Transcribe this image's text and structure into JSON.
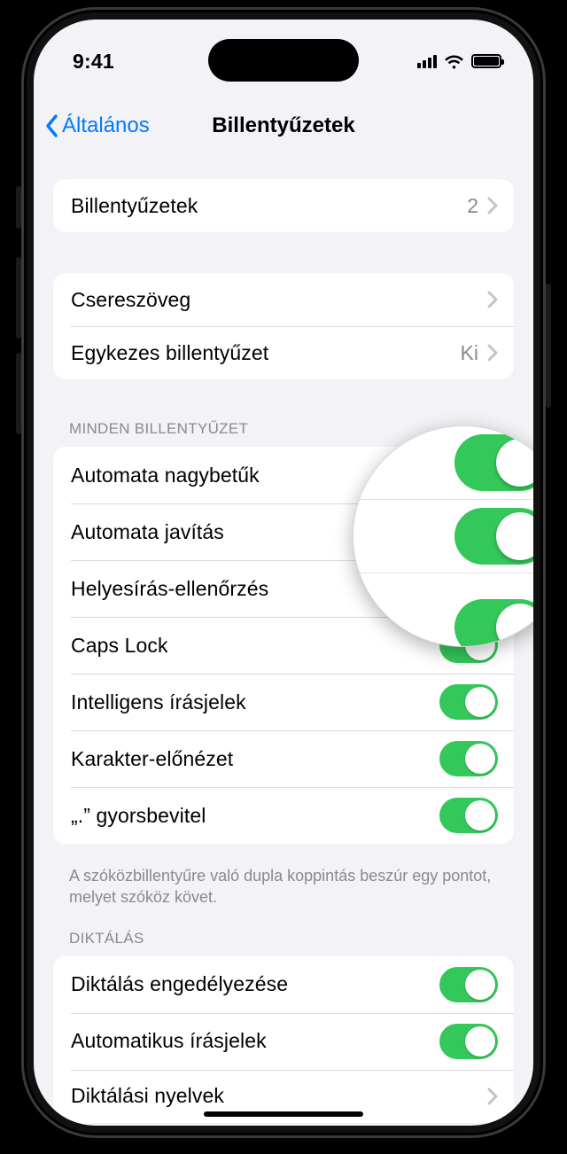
{
  "status": {
    "time": "9:41"
  },
  "nav": {
    "back": "Általános",
    "title": "Billentyűzetek"
  },
  "group1": {
    "keyboards": {
      "label": "Billentyűzetek",
      "count": "2"
    }
  },
  "group2": {
    "textreplace": {
      "label": "Csereszöveg"
    },
    "onehanded": {
      "label": "Egykezes billentyűzet",
      "value": "Ki"
    }
  },
  "allkb": {
    "header": "MINDEN BILLENTYŰZET",
    "rows": [
      {
        "label": "Automata nagybetűk",
        "on": true
      },
      {
        "label": "Automata javítás",
        "on": true
      },
      {
        "label": "Helyesírás-ellenőrzés",
        "on": true
      },
      {
        "label": "Caps Lock",
        "on": true
      },
      {
        "label": "Intelligens írásjelek",
        "on": true
      },
      {
        "label": "Karakter-előnézet",
        "on": true
      },
      {
        "label": "„.” gyorsbevitel",
        "on": true
      }
    ],
    "footer": "A szóközbillentyűre való dupla koppintás beszúr egy pontot, melyet szóköz követ."
  },
  "dictation": {
    "header": "DIKTÁLÁS",
    "rows": [
      {
        "label": "Diktálás engedélyezése",
        "on": true
      },
      {
        "label": "Automatikus írásjelek",
        "on": true
      }
    ],
    "languages": {
      "label": "Diktálási nyelvek"
    }
  }
}
